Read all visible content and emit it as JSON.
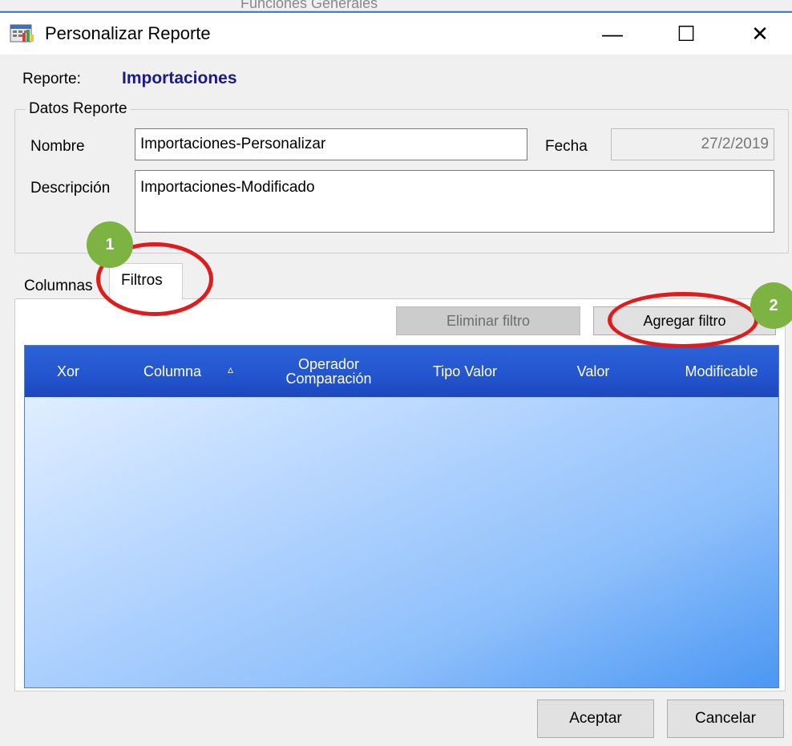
{
  "background_window": {
    "partial_text": "Funciones Generales"
  },
  "window": {
    "title": "Personalizar Reporte",
    "controls": {
      "minimize": "—",
      "maximize": "☐",
      "close": "✕"
    }
  },
  "report": {
    "label": "Reporte:",
    "value": "Importaciones"
  },
  "datos_reporte": {
    "group_title": "Datos Reporte",
    "nombre_label": "Nombre",
    "nombre_value": "Importaciones-Personalizar",
    "fecha_label": "Fecha",
    "fecha_value": "27/2/2019",
    "descripcion_label": "Descripción",
    "descripcion_value": "Importaciones-Modificado"
  },
  "tabs": [
    {
      "label": "Columnas"
    },
    {
      "label": "Filtros",
      "active": true
    }
  ],
  "filtros": {
    "eliminar_label": "Eliminar filtro",
    "agregar_label": "Agregar filtro",
    "columns": [
      "Xor",
      "Columna",
      "Operador\nComparación",
      "Tipo Valor",
      "Valor",
      "Modificable"
    ],
    "sort_indicator": "▵"
  },
  "footer": {
    "aceptar_label": "Aceptar",
    "cancelar_label": "Cancelar"
  },
  "annotations": {
    "step1": "1",
    "step2": "2",
    "color": "#7cb342",
    "ring_color": "#e01b1b"
  }
}
